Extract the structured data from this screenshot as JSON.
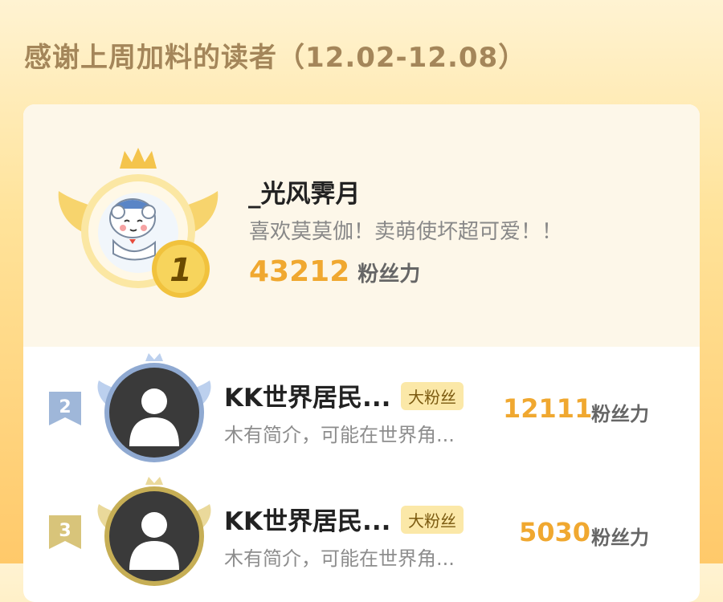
{
  "header": {
    "title": "感谢上周加料的读者（12.02-12.08）"
  },
  "champion": {
    "rank": "1",
    "name": "_光风霁月",
    "bio": "喜欢莫莫伽！卖萌使坏超可爱！！",
    "score": "43212",
    "unit": "粉丝力"
  },
  "rows": [
    {
      "rank": "2",
      "name": "KK世界居民...",
      "tag": "大粉丝",
      "bio": "木有简介，可能在世界角...",
      "score": "12111",
      "unit": "粉丝力"
    },
    {
      "rank": "3",
      "name": "KK世界居民...",
      "tag": "大粉丝",
      "bio": "木有简介，可能在世界角...",
      "score": "5030",
      "unit": "粉丝力"
    }
  ],
  "colors": {
    "accent": "#f0a830",
    "title": "#a4865a",
    "silver": "#9fb7d9",
    "bronze": "#d8c47a"
  },
  "icons": [
    "crown-icon",
    "wing-icon",
    "rank-medal-icon",
    "rank-ribbon-icon",
    "default-avatar-icon"
  ]
}
